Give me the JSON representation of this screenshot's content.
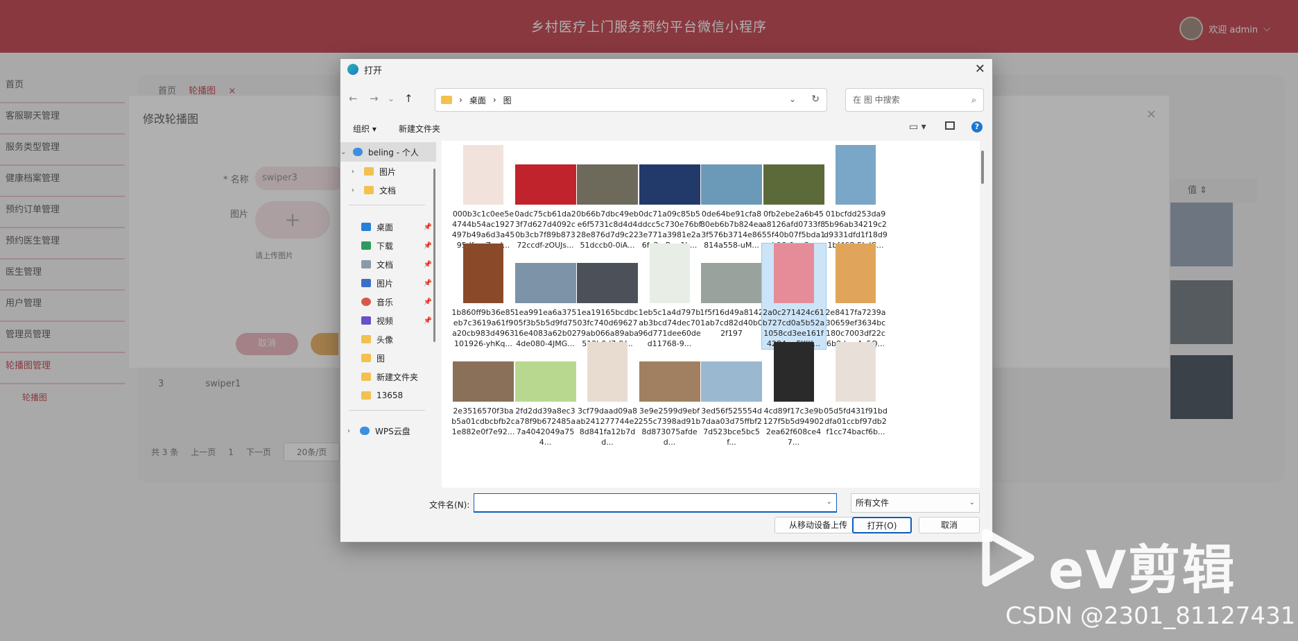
{
  "app": {
    "title": "乡村医疗上门服务预约平台微信小程序",
    "welcome": "欢迎 admin",
    "chevron": "⌵"
  },
  "sidebar": {
    "items": [
      {
        "label": "首页"
      },
      {
        "label": "客服聊天管理"
      },
      {
        "label": "服务类型管理"
      },
      {
        "label": "健康档案管理"
      },
      {
        "label": "预约订单管理"
      },
      {
        "label": "预约医生管理"
      },
      {
        "label": "医生管理"
      },
      {
        "label": "用户管理"
      },
      {
        "label": "管理员管理"
      },
      {
        "label": "轮播图管理"
      }
    ],
    "sub_item": "轮播图"
  },
  "breadcrumb": {
    "home": "首页",
    "current": "轮播图",
    "close": "×"
  },
  "table": {
    "value_header": "值 ⇕",
    "row3_index": "3",
    "row3_name": "swiper1"
  },
  "pager": {
    "total": "共 3 条",
    "prev": "上一页",
    "page": "1",
    "next": "下一页",
    "size": "20条/页"
  },
  "edit_modal": {
    "title": "修改轮播图",
    "close": "×",
    "name_label": "* 名称",
    "name_value": "swiper3",
    "image_label": "图片",
    "upload_plus": "+",
    "upload_hint": "请上传图片",
    "cancel_label": "取消"
  },
  "file_dialog": {
    "title": "打开",
    "close": "✕",
    "nav_back": "←",
    "nav_forward": "→",
    "nav_recent": "⌄",
    "nav_up": "↑",
    "path": [
      "桌面",
      "图"
    ],
    "path_sep": "›",
    "search_placeholder": "在 图 中搜索",
    "search_icon": "⌕",
    "organize": "组织 ▾",
    "new_folder": "新建文件夹",
    "help": "?",
    "nav_items": [
      {
        "label": "beling - 个人",
        "icon": "cloud-icon"
      },
      {
        "label": "图片",
        "icon": "folder-icon"
      },
      {
        "label": "文档",
        "icon": "folder-icon"
      },
      {
        "label": "桌面",
        "icon": "desktop-icon",
        "pinned": true
      },
      {
        "label": "下载",
        "icon": "download-icon",
        "pinned": true
      },
      {
        "label": "文档",
        "icon": "document-icon",
        "pinned": true
      },
      {
        "label": "图片",
        "icon": "picture-icon",
        "pinned": true
      },
      {
        "label": "音乐",
        "icon": "music-icon",
        "pinned": true
      },
      {
        "label": "视频",
        "icon": "video-icon",
        "pinned": true
      },
      {
        "label": "头像",
        "icon": "folder-icon"
      },
      {
        "label": "图",
        "icon": "folder-icon"
      },
      {
        "label": "新建文件夹",
        "icon": "folder-icon"
      },
      {
        "label": "13658",
        "icon": "folder-icon"
      },
      {
        "label": "WPS云盘",
        "icon": "cloud-icon"
      }
    ],
    "files": [
      {
        "name": "000b3c1c0ee5e4744b54ac1927497b49a6d3a4595dfac-ZanJ...",
        "color": "#f2e2dc",
        "shape": "tall"
      },
      {
        "name": "0adc75cb61da23f7d627d4092c0b3cb7f89b87372ccdf-zOUJs...",
        "color": "#c0232b",
        "shape": "wide"
      },
      {
        "name": "0b66b7dbc49ebe6f5731c8d4d428e876d7d9c2251dccb0-0iA...",
        "color": "#6d6a5c",
        "shape": "wide"
      },
      {
        "name": "0dc71a09c85b5ddcc5c730e76bf3e771a3981e2a6fc2-vRgp1k...",
        "color": "#223a6a",
        "shape": "wide"
      },
      {
        "name": "0de64be91cfa880eb6b7b824ea3f576b3714e86814a558-uM...",
        "color": "#6a9ab8",
        "shape": "wide"
      },
      {
        "name": "0fb2ebe2a6b45a8126afd0733f855f40b07f5bda1eb18-9nvCv...",
        "color": "#5c6a3a",
        "shape": "wide"
      },
      {
        "name": "01bcfdd253da95b96ab34219c2d9331dfd1f18d91bf468-5LdC...",
        "color": "#7aa6c8",
        "shape": "tall"
      },
      {
        "name": "1b860ff9b36e85eb7c3619a61f9a20cb983d4963101926-yhKq...",
        "color": "#8a4a2a",
        "shape": "tall"
      },
      {
        "name": "1ea991ea6a37505f3b5b5d9fd7516e4083a62b024de080-4JMG...",
        "color": "#7c93a8",
        "shape": "wide"
      },
      {
        "name": "1ea19165bcdbc03fc740d6962779ab066a89aba512b0d7-fV...",
        "color": "#4c5058",
        "shape": "wide"
      },
      {
        "name": "1eb5c1a4d797bab3bcd74dec7096d771dee60ded11768-9...",
        "color": "#e8eee6",
        "shape": "tall"
      },
      {
        "name": "1f5f16d49a81421ab7cd82d40b02f197",
        "color": "#9aa29e",
        "shape": "wide"
      },
      {
        "name": "2a0c271424c61b727cd0a5b52a1058cd3ee161f4284-mFKIK...",
        "color": "#e58c98",
        "shape": "tall"
      },
      {
        "name": "2e8417fa7239a30659ef3634bc180c7003df22c6b8dac-Ac5Q...",
        "color": "#e0a55a",
        "shape": "tall"
      },
      {
        "name": "2e3516570f3bab5a01cdbcbfb2c1e882e0f7e92...",
        "color": "#8a7058",
        "shape": "wide"
      },
      {
        "name": "2fd2dd39a8ec3a78f9b672485a7a4042049a754...",
        "color": "#b8d890",
        "shape": "wide"
      },
      {
        "name": "3cf79daad09a8ab241277744e28d841fa12b7dd...",
        "color": "#e8dcd0",
        "shape": "tall"
      },
      {
        "name": "3e9e2599d9ebf255c7398ad91b8d873075afded...",
        "color": "#a08060",
        "shape": "wide"
      },
      {
        "name": "3ed56f525554d7daa03d75ffbf27d523bce5bc5f...",
        "color": "#9ab8d0",
        "shape": "wide"
      },
      {
        "name": "4cd89f17c3e9b127f5b5d949022ea62f608ce47...",
        "color": "#2a2a2a",
        "shape": "tall"
      },
      {
        "name": "05d5fd431f91bddfa01ccbf97db2f1cc74bacf6b...",
        "color": "#e8e0d8",
        "shape": "tall"
      }
    ],
    "selected_file_index": 12,
    "filename_label": "文件名(N):",
    "filename_value": "",
    "filetype": "所有文件",
    "mobile_upload": "从移动设备上传",
    "open": "打开(O)",
    "cancel": "取消"
  },
  "watermark": {
    "brand": "eV剪辑",
    "csdn": "CSDN @2301_81127431"
  }
}
